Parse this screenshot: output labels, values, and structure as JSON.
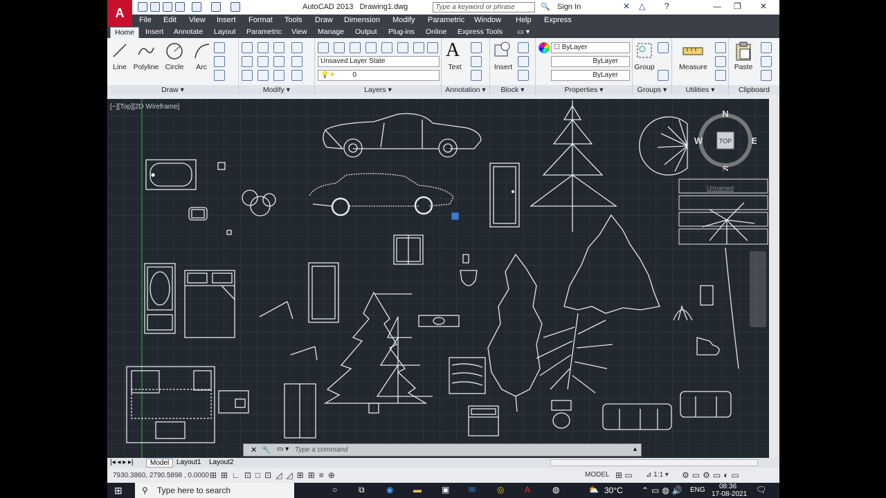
{
  "title": {
    "app": "AutoCAD 2013",
    "file": "Drawing1.dwg",
    "search_placeholder": "Type a keyword or phrase",
    "signin": "Sign In"
  },
  "menu": [
    "File",
    "Edit",
    "View",
    "Insert",
    "Format",
    "Tools",
    "Draw",
    "Dimension",
    "Modify",
    "Parametric",
    "Window",
    "Help",
    "Express"
  ],
  "tabs": [
    "Home",
    "Insert",
    "Annotate",
    "Layout",
    "Parametric",
    "View",
    "Manage",
    "Output",
    "Plug-ins",
    "Online",
    "Express Tools"
  ],
  "draw": {
    "line": "Line",
    "polyline": "Polyline",
    "circle": "Circle",
    "arc": "Arc",
    "title": "Draw"
  },
  "modify": {
    "title": "Modify"
  },
  "layers": {
    "state": "Unsaved Layer State",
    "current": "0",
    "title": "Layers"
  },
  "annotation": {
    "text": "Text",
    "title": "Annotation"
  },
  "block": {
    "insert": "Insert",
    "title": "Block"
  },
  "properties": {
    "color": "ByLayer",
    "linetype": "ByLayer",
    "lineweight": "ByLayer",
    "title": "Properties"
  },
  "groups": {
    "group": "Group",
    "title": "Groups"
  },
  "utilities": {
    "measure": "Measure",
    "title": "Utilities"
  },
  "clipboard": {
    "paste": "Paste",
    "title": "Clipboard"
  },
  "viewport": {
    "label": "[−][Top][2D Wireframe]"
  },
  "viewcube": {
    "n": "N",
    "s": "S",
    "e": "E",
    "w": "W",
    "top": "TOP"
  },
  "unnamed": "Unnamed",
  "command": {
    "placeholder": "Type  a  command"
  },
  "layout_tabs": [
    "Model",
    "Layout1",
    "Layout2"
  ],
  "status": {
    "coords": "7930.3860, 2790.5898 , 0.0000",
    "model": "MODEL",
    "scale": "1:1"
  },
  "taskbar": {
    "search": "Type here to search",
    "temp": "30°C",
    "lang": "ENG",
    "time": "08:36",
    "date": "17-08-2021"
  }
}
